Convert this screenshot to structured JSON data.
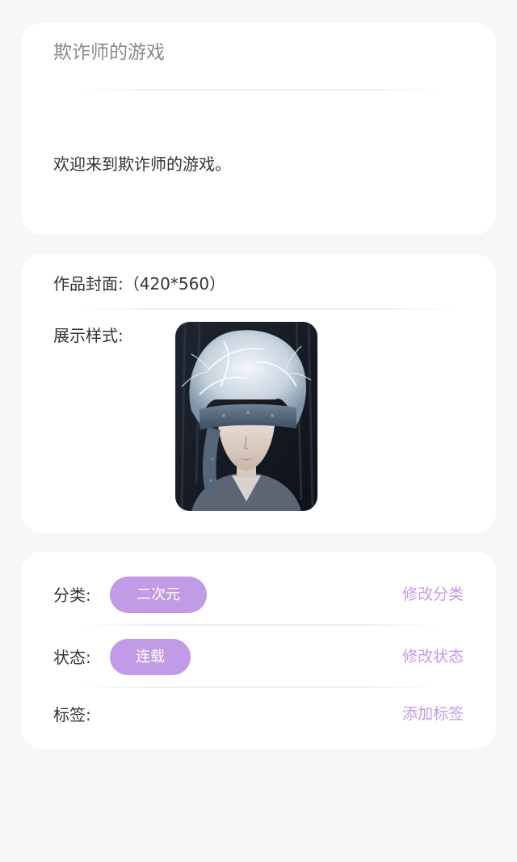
{
  "intro": {
    "title": "欺诈师的游戏",
    "description": "欢迎来到欺诈师的游戏。"
  },
  "cover_section": {
    "cover_label": "作品封面:（420*560）",
    "display_style_label": "展示样式:"
  },
  "meta": {
    "category": {
      "label": "分类:",
      "value": "二次元",
      "action": "修改分类"
    },
    "status": {
      "label": "状态:",
      "value": "连载",
      "action": "修改状态"
    },
    "tags": {
      "label": "标签:",
      "action": "添加标签"
    }
  },
  "colors": {
    "accent": "#c19be6",
    "background": "#f7f7f7",
    "card": "#ffffff"
  }
}
